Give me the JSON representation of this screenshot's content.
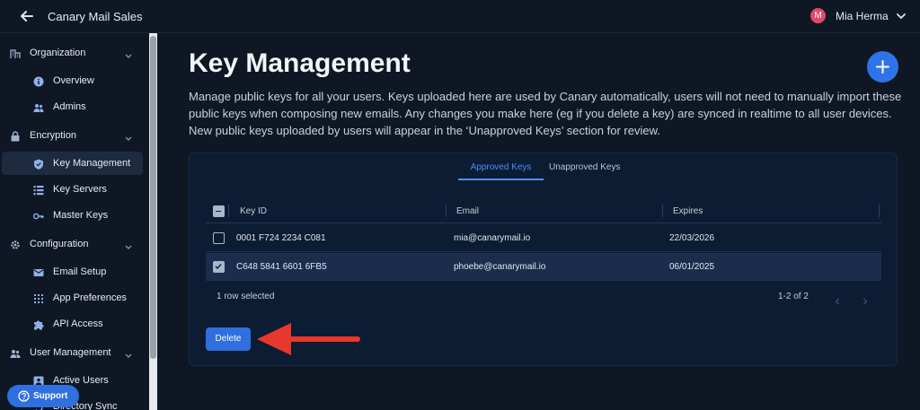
{
  "header": {
    "title": "Canary Mail Sales",
    "user": {
      "initial": "M",
      "name": "Mia Herma"
    }
  },
  "sidebar": {
    "groups": [
      {
        "label": "Organization",
        "icon": "building-icon",
        "items": [
          {
            "label": "Overview",
            "icon": "info-icon"
          },
          {
            "label": "Admins",
            "icon": "users-icon"
          }
        ]
      },
      {
        "label": "Encryption",
        "icon": "lock-icon",
        "items": [
          {
            "label": "Key Management",
            "icon": "shield-check-icon",
            "active": true
          },
          {
            "label": "Key Servers",
            "icon": "list-icon"
          },
          {
            "label": "Master Keys",
            "icon": "key-icon"
          }
        ]
      },
      {
        "label": "Configuration",
        "icon": "gear-icon",
        "items": [
          {
            "label": "Email Setup",
            "icon": "envelope-icon"
          },
          {
            "label": "App Preferences",
            "icon": "dots-grid-icon"
          },
          {
            "label": "API Access",
            "icon": "puzzle-icon"
          }
        ]
      },
      {
        "label": "User Management",
        "icon": "users-icon",
        "items": [
          {
            "label": "Active Users",
            "icon": "user-box-icon"
          },
          {
            "label": "Directory Sync",
            "icon": "sync-icon"
          }
        ]
      }
    ],
    "support_label": "Support"
  },
  "main": {
    "title": "Key Management",
    "description": "Manage public keys for all your users. Keys uploaded here are used by Canary automatically, users will not need to manually import these public keys when composing new emails. Any changes you make here (eg if you delete a key) are synced in realtime to all user devices. New public keys uploaded by users will appear in the ‘Unapproved Keys’ section for review.",
    "tabs": [
      {
        "label": "Approved Keys",
        "active": true
      },
      {
        "label": "Unapproved Keys",
        "active": false
      }
    ],
    "table": {
      "columns": [
        "Key ID",
        "Email",
        "Expires"
      ],
      "rows": [
        {
          "key_id": "0001 F724 2234 C081",
          "email": "mia@canarymail.io",
          "expires": "22/03/2026",
          "selected": false
        },
        {
          "key_id": "C648 5841 6601 6FB5",
          "email": "phoebe@canarymail.io",
          "expires": "06/01/2025",
          "selected": true
        }
      ],
      "footer": {
        "selection": "1 row selected",
        "pagination": "1-2 of 2"
      }
    },
    "delete_label": "Delete"
  },
  "colors": {
    "accent": "#2f6fe0",
    "tab_active": "#4b8ff5",
    "annotation_arrow": "#e8372c",
    "avatar": "#e0496a"
  }
}
